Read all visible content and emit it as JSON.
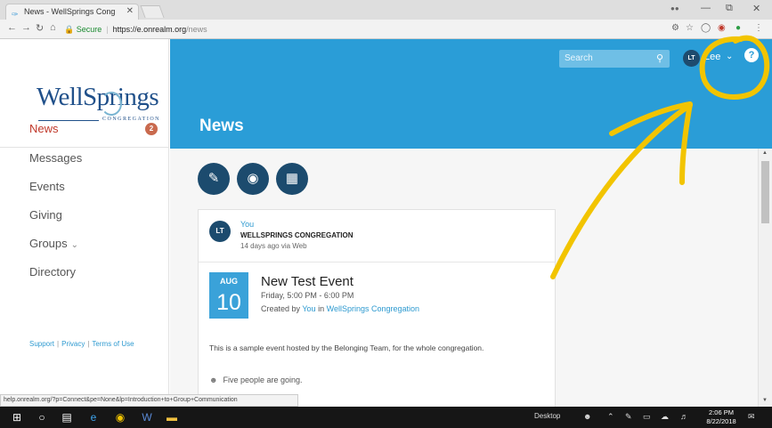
{
  "browser": {
    "tab_title": "News - WellSprings Cong",
    "secure_label": "Secure",
    "url_host": "https://e.onrealm.org",
    "url_path": "/news",
    "status_url": "help.onrealm.org/?p=Connect&pe=None&lp=Introduction+to+Group+Communication"
  },
  "logo": {
    "main": "WellSprings",
    "sub": "CONGREGATION"
  },
  "sidebar": {
    "items": [
      {
        "label": "News",
        "badge": "2"
      },
      {
        "label": "Messages"
      },
      {
        "label": "Events"
      },
      {
        "label": "Giving"
      },
      {
        "label": "Groups"
      },
      {
        "label": "Directory"
      }
    ],
    "footer": {
      "support": "Support",
      "privacy": "Privacy",
      "terms": "Terms of Use"
    }
  },
  "header": {
    "search_placeholder": "Search",
    "user_initials": "LT",
    "user_name": "Lee",
    "page_title": "News"
  },
  "post": {
    "avatar_initials": "LT",
    "author": "You",
    "group": "WELLSPRINGS CONGREGATION",
    "meta": "14 days ago via Web",
    "event": {
      "month": "AUG",
      "day": "10",
      "title": "New Test Event",
      "time": "Friday, 5:00 PM - 6:00 PM",
      "created_prefix": "Created by",
      "created_by": "You",
      "created_in": "in",
      "created_group": "WellSprings Congregation"
    },
    "description": "This is a sample event hosted by the Belonging Team, for the whole congregation.",
    "going": "Five people are going."
  },
  "taskbar": {
    "desktop_label": "Desktop",
    "time": "2:06 PM",
    "date": "8/22/2018"
  },
  "colors": {
    "header_blue": "#2a9dd7",
    "navy": "#1c4b6e",
    "annotation_yellow": "#f2c400",
    "active_red": "#c0392b"
  }
}
